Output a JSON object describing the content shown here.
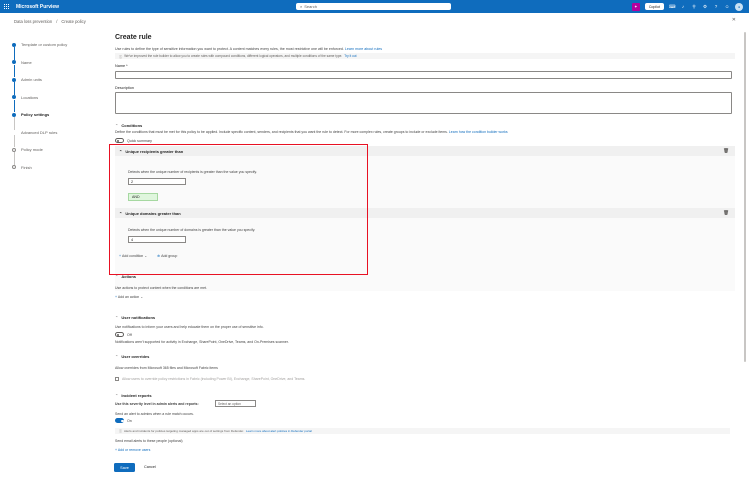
{
  "app": {
    "brand": "Microsoft Purview",
    "search_placeholder": "Search",
    "copilot_label": "Copilot"
  },
  "breadcrumb": {
    "items": [
      "Data loss prevention",
      "Create policy"
    ]
  },
  "steps": [
    {
      "label": "Template or custom policy",
      "state": "done"
    },
    {
      "label": "Name",
      "state": "done"
    },
    {
      "label": "Admin units",
      "state": "done"
    },
    {
      "label": "Locations",
      "state": "done"
    },
    {
      "label": "Policy settings",
      "state": "current"
    },
    {
      "label": "Advanced DLP rules",
      "state": "sub"
    },
    {
      "label": "Policy mode",
      "state": "todo"
    },
    {
      "label": "Finish",
      "state": "todo"
    }
  ],
  "panel": {
    "title": "Create rule",
    "intro": "Use rules to define the type of sensitive information you want to protect. A content matches every rules, the most restrictive one will be enforced.",
    "intro_link": "Learn more about rules",
    "infobar_text": "We've improved the rule builder to allow you to create rules with compound conditions, different logical operators, and multiple conditions of the same type.",
    "infobar_link": "Try it out",
    "name_label": "Name *",
    "description_label": "Description"
  },
  "conditions": {
    "header": "Conditions",
    "desc": "Define the conditions that must be met for this policy to be applied. Include specific content, senders, and recipients that you want the rule to detect. For more complex rules, create groups to include or exclude items.",
    "desc_link": "Learn how the condition builder works",
    "quick_summary_label": "Quick summary",
    "items": [
      {
        "title": "Unique recipients greater than",
        "desc": "Detects when the unique number of recipients is greater than the value you specify.",
        "value": "2"
      },
      {
        "title": "Unique domains greater than",
        "desc": "Detects when the unique number of domains is greater than the value you specify.",
        "value": "4"
      }
    ],
    "operator": "AND",
    "add_condition": "Add condition",
    "add_group": "Add group"
  },
  "actions": {
    "header": "Actions",
    "desc": "Use actions to protect content when the conditions are met.",
    "add_action": "Add an action"
  },
  "user_notifications": {
    "header": "User notifications",
    "desc": "Use notifications to inform your users and help educate them on the proper use of sensitive info.",
    "toggle_label": "Off",
    "note": "Notifications aren't supported for activity in Exchange, SharePoint, OneDrive, Teams, and On-Premises scanner."
  },
  "user_overrides": {
    "header": "User overrides",
    "desc": "Allow overrides from Microsoft 365 files and Microsoft Fabric items",
    "checkbox_label": "Allow users to override policy restrictions in Fabric (including Power BI), Exchange, SharePoint, OneDrive, and Teams."
  },
  "incident_reports": {
    "header": "Incident reports",
    "severity_label": "Use this severity level in admin alerts and reports:",
    "severity_placeholder": "Select an option",
    "alert_label": "Send an alert to admins when a rule match occurs.",
    "toggle_label": "On",
    "info_text": "Alerts and incidents for policies targeting managed apps are out of settings from Defender.",
    "info_link": "Learn more about alert policies in Defender portal",
    "email_label": "Send email alerts to these people (optional)",
    "add_remove": "Add or remove users"
  },
  "footer": {
    "save": "Save",
    "cancel": "Cancel"
  }
}
